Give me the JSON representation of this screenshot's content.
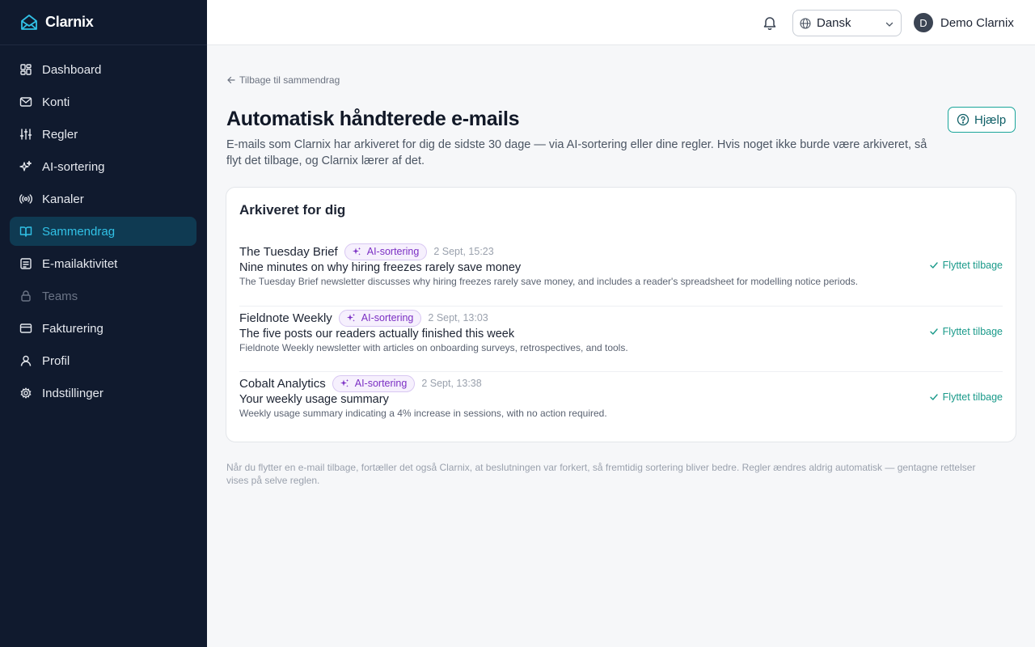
{
  "brand": {
    "name": "Clarnix"
  },
  "nav": {
    "items": [
      {
        "label": "Dashboard",
        "icon": "grid-icon",
        "state": "normal"
      },
      {
        "label": "Konti",
        "icon": "mail-icon",
        "state": "normal"
      },
      {
        "label": "Regler",
        "icon": "sliders-icon",
        "state": "normal"
      },
      {
        "label": "AI-sortering",
        "icon": "sparkles-icon",
        "state": "normal"
      },
      {
        "label": "Kanaler",
        "icon": "radio-icon",
        "state": "normal"
      },
      {
        "label": "Sammendrag",
        "icon": "book-open-icon",
        "state": "active"
      },
      {
        "label": "E-mailaktivitet",
        "icon": "activity-list-icon",
        "state": "normal"
      },
      {
        "label": "Teams",
        "icon": "lock-icon",
        "state": "disabled"
      },
      {
        "label": "Fakturering",
        "icon": "credit-card-icon",
        "state": "normal"
      },
      {
        "label": "Profil",
        "icon": "user-icon",
        "state": "normal"
      },
      {
        "label": "Indstillinger",
        "icon": "gear-icon",
        "state": "normal"
      }
    ]
  },
  "topbar": {
    "language": "Dansk",
    "user_initial": "D",
    "user_name": "Demo Clarnix"
  },
  "main": {
    "back_link": "Tilbage til sammendrag",
    "title": "Automatisk håndterede e-mails",
    "description": "E-mails som Clarnix har arkiveret for dig de sidste 30 dage — via AI-sortering eller dine regler. Hvis noget ikke burde være arkiveret, så flyt det tilbage, og Clarnix lærer af det.",
    "help_label": "Hjælp",
    "card": {
      "title": "Arkiveret for dig",
      "rows": [
        {
          "sender": "The Tuesday Brief",
          "badge": "AI-sortering",
          "timestamp": "2 Sept, 15:23",
          "subject": "Nine minutes on why hiring freezes rarely save money",
          "preview": "The Tuesday Brief newsletter discusses why hiring freezes rarely save money, and includes a reader's spreadsheet for modelling notice periods.",
          "status": "Flyttet tilbage"
        },
        {
          "sender": "Fieldnote Weekly",
          "badge": "AI-sortering",
          "timestamp": "2 Sept, 13:03",
          "subject": "The five posts our readers actually finished this week",
          "preview": "Fieldnote Weekly newsletter with articles on onboarding surveys, retrospectives, and tools.",
          "status": "Flyttet tilbage"
        },
        {
          "sender": "Cobalt Analytics",
          "badge": "AI-sortering",
          "timestamp": "2 Sept, 13:38",
          "subject": "Your weekly usage summary",
          "preview": "Weekly usage summary indicating a 4% increase in sessions, with no action required.",
          "status": "Flyttet tilbage"
        }
      ]
    },
    "footnote": "Når du flytter en e-mail tilbage, fortæller det også Clarnix, at beslutningen var forkert, så fremtidig sortering bliver bedre. Regler ændres aldrig automatisk — gentagne rettelser vises på selve reglen."
  },
  "colors": {
    "sidebar_bg": "#101a2e",
    "active_text": "#31c1e6",
    "active_bg": "#0f3a52",
    "badge_purple": "#7b2fc4",
    "success_teal": "#1a9a8a"
  }
}
